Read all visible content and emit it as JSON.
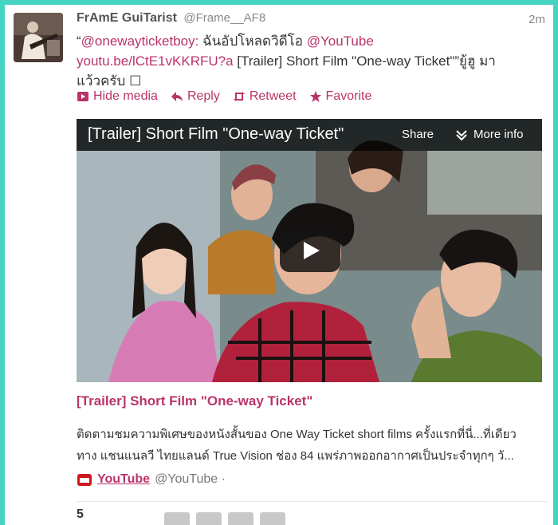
{
  "tweet": {
    "fullname": "FrAmE GuiTarist",
    "handle": "@Frame__AF8",
    "time": "2m",
    "text_prefix": "“",
    "mention": "@onewayticketboy:",
    "text_mid": " ฉันอัปโหลดวิดีโอ ",
    "youtube_mention": "@YouTube",
    "link": "youtu.be/lCtE1vKKRFU?a",
    "text_after_link": " [Trailer] Short Film \"One-way Ticket\"”ยู้ฮู มา",
    "text_line3": "แว้วครับ ☐"
  },
  "actions": {
    "hide_media": "Hide media",
    "reply": "Reply",
    "retweet": "Retweet",
    "favorite": "Favorite"
  },
  "video": {
    "title": "[Trailer] Short Film \"One-way Ticket\"",
    "share": "Share",
    "more_info": "More info"
  },
  "card": {
    "title": "[Trailer] Short Film \"One-way Ticket\"",
    "description": "ติดตามชมความพิเศษของหนังสั้นของ One Way Ticket short films ครั้งแรกที่นี่...ที่เดียว ทาง แชนแนลวี ไทยแลนด์ True Vision ช่อง 84 แพร่ภาพออกอากาศเป็นประจำทุกๆ วั...",
    "source_name": "YouTube",
    "source_handle": "@YouTube ·"
  },
  "stats": {
    "count": "5"
  },
  "colors": {
    "accent": "#b9346a",
    "frame": "#45d3c4"
  }
}
